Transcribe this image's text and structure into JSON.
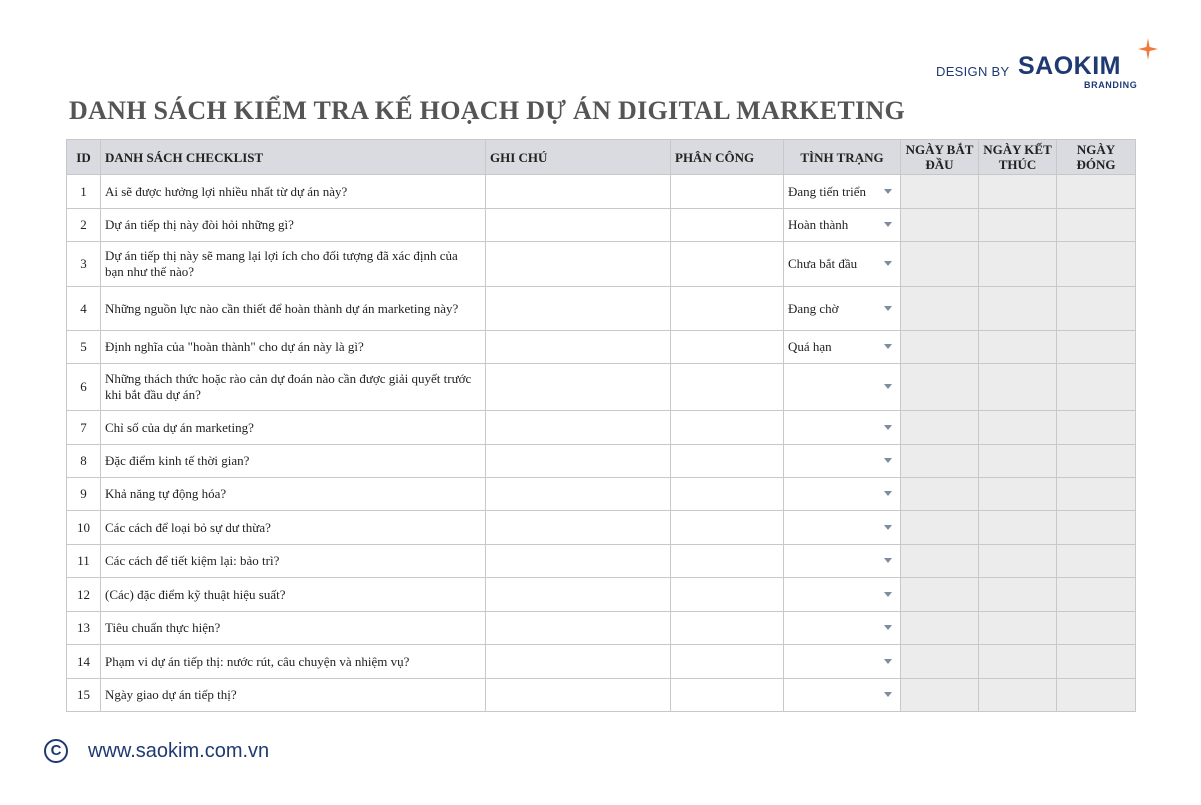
{
  "brand": {
    "design_by": "DESIGN BY",
    "logo_text": "SAOKIM",
    "sub_text": "BRANDING",
    "accent": "#f07a3a",
    "color": "#1f3a73"
  },
  "title": "DANH SÁCH KIỂM TRA KẾ HOẠCH DỰ ÁN DIGITAL MARKETING",
  "table": {
    "headers": {
      "id": "ID",
      "checklist": "DANH SÁCH CHECKLIST",
      "note": "GHI CHÚ",
      "assign": "PHÂN CÔNG",
      "status": "TÌNH TRẠNG",
      "start": "NGÀY BẮT ĐẦU",
      "end": "NGÀY KẾT THÚC",
      "close": "NGÀY ĐÓNG"
    },
    "rows": [
      {
        "id": "1",
        "question": "Ai sẽ được hưởng lợi nhiều nhất từ dự án này?",
        "status": "Đang tiến triển"
      },
      {
        "id": "2",
        "question": "Dự án tiếp thị này đòi hỏi những gì?",
        "status": "Hoàn thành"
      },
      {
        "id": "3",
        "question": "Dự án tiếp thị này sẽ mang lại lợi ích cho đối tượng đã xác định của bạn như thế nào?",
        "status": "Chưa bắt đầu"
      },
      {
        "id": "4",
        "question": "Những nguồn lực nào cần thiết để hoàn thành dự án marketing này?",
        "status": "Đang chờ"
      },
      {
        "id": "5",
        "question": "Định nghĩa của \"hoàn thành\" cho dự án này là gì?",
        "status": "Quá hạn"
      },
      {
        "id": "6",
        "question": "Những thách thức hoặc rào cản dự đoán nào cần được giải quyết trước khi bắt đầu dự án?",
        "status": ""
      },
      {
        "id": "7",
        "question": "Chỉ số của dự án marketing?",
        "status": ""
      },
      {
        "id": "8",
        "question": "Đặc điểm kinh tế thời gian?",
        "status": ""
      },
      {
        "id": "9",
        "question": "Khả năng tự động hóa?",
        "status": ""
      },
      {
        "id": "10",
        "question": "Các cách để loại bỏ sự dư thừa?",
        "status": ""
      },
      {
        "id": "11",
        "question": "Các cách để tiết kiệm lại: bảo trì?",
        "status": ""
      },
      {
        "id": "12",
        "question": "(Các) đặc điểm kỹ thuật hiệu suất?",
        "status": ""
      },
      {
        "id": "13",
        "question": "Tiêu chuẩn thực hiện?",
        "status": ""
      },
      {
        "id": "14",
        "question": "Phạm vi dự án tiếp thị: nước rút, câu chuyện và nhiệm vụ?",
        "status": ""
      },
      {
        "id": "15",
        "question": "Ngày giao dự án tiếp thị?",
        "status": ""
      }
    ]
  },
  "footer": {
    "copyright_symbol": "C",
    "url": "www.saokim.com.vn"
  }
}
